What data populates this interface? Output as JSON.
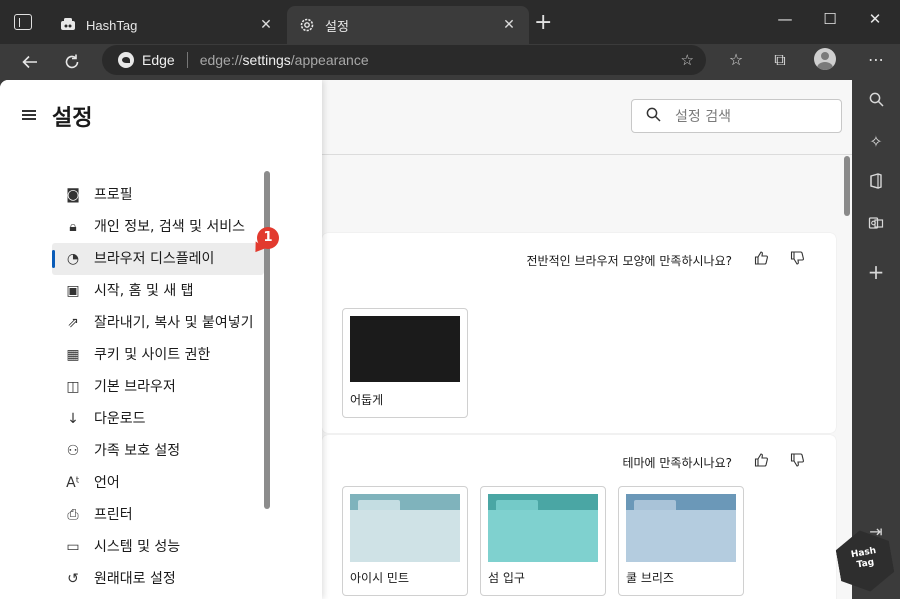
{
  "tabs": [
    {
      "title": "HashTag",
      "close": "✕"
    },
    {
      "title": "설정",
      "close": "✕"
    }
  ],
  "window_controls": {
    "minimize": "—",
    "maximize": "☐",
    "close": "✕"
  },
  "address_bar": {
    "site_label": "Edge",
    "url_prefix": "edge://",
    "url_bold": "settings",
    "url_suffix": "/appearance"
  },
  "search": {
    "placeholder": "설정 검색"
  },
  "sidebar": {
    "title": "설정",
    "items": [
      {
        "label": "프로필",
        "icon": "profile-icon"
      },
      {
        "label": "개인 정보, 검색 및 서비스",
        "icon": "lock-icon"
      },
      {
        "label": "브라우저 디스플레이",
        "icon": "palette-icon",
        "selected": true
      },
      {
        "label": "시작, 홈 및 새 탭",
        "icon": "home-tab-icon"
      },
      {
        "label": "잘라내기, 복사 및 붙여넣기",
        "icon": "share-icon"
      },
      {
        "label": "쿠키 및 사이트 권한",
        "icon": "cookie-icon"
      },
      {
        "label": "기본 브라우저",
        "icon": "default-browser-icon"
      },
      {
        "label": "다운로드",
        "icon": "download-icon"
      },
      {
        "label": "가족 보호 설정",
        "icon": "family-icon"
      },
      {
        "label": "언어",
        "icon": "language-icon"
      },
      {
        "label": "프린터",
        "icon": "printer-icon"
      },
      {
        "label": "시스템 및 성능",
        "icon": "system-icon"
      },
      {
        "label": "원래대로 설정",
        "icon": "reset-icon"
      }
    ]
  },
  "badge": {
    "number": "1"
  },
  "section1": {
    "feedback_text": "전반적인 브라우저 모양에 만족하시나요?",
    "tiles": [
      {
        "label": "어둡게"
      }
    ]
  },
  "section2": {
    "feedback_text": "테마에 만족하시나요?",
    "tiles": [
      {
        "label": "아이시 민트",
        "color_top": "#7fb3bc",
        "color_body": "#cfe2e6",
        "color_tab": "#c4dde2"
      },
      {
        "label": "섬 입구",
        "color_top": "#4aa6a4",
        "color_body": "#7fd1cf",
        "color_tab": "#74cac8"
      },
      {
        "label": "쿨 브리즈",
        "color_top": "#6b98b8",
        "color_body": "#b4ccdf",
        "color_tab": "#a9c3d8"
      }
    ]
  },
  "watermark": {
    "line1": "Hash",
    "line2": "Tag"
  }
}
